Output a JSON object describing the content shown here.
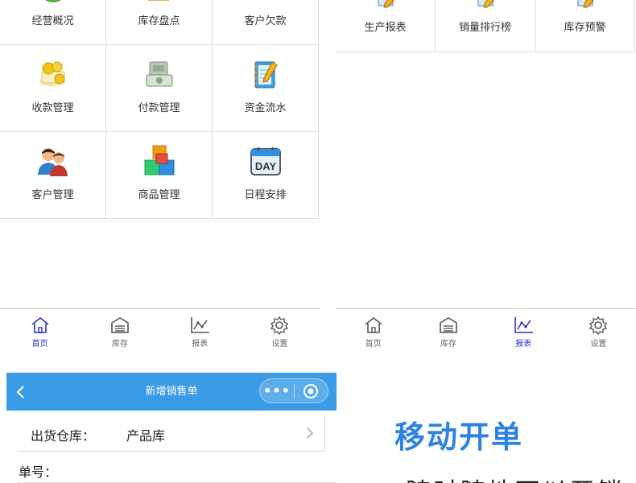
{
  "home": {
    "grid": [
      {
        "label": "经营概况",
        "icon": "overview-icon"
      },
      {
        "label": "库存盘点",
        "icon": "inventory-check-icon"
      },
      {
        "label": "客户欠款",
        "icon": "customer-debt-icon"
      },
      {
        "label": "收款管理",
        "icon": "receipt-coins-icon"
      },
      {
        "label": "付款管理",
        "icon": "payment-cash-icon"
      },
      {
        "label": "资金流水",
        "icon": "notebook-pencil-icon"
      },
      {
        "label": "客户管理",
        "icon": "customers-icon"
      },
      {
        "label": "商品管理",
        "icon": "product-boxes-icon"
      },
      {
        "label": "日程安排",
        "icon": "day-calendar-icon"
      }
    ],
    "tabs": [
      {
        "label": "首页",
        "icon": "home-icon",
        "active": true
      },
      {
        "label": "库存",
        "icon": "warehouse-icon",
        "active": false
      },
      {
        "label": "报表",
        "icon": "chart-icon",
        "active": false
      },
      {
        "label": "设置",
        "icon": "gear-icon",
        "active": false
      }
    ]
  },
  "reports": {
    "grid": [
      {
        "label": "生产报表",
        "icon": "report-doc-icon"
      },
      {
        "label": "销量排行榜",
        "icon": "report-doc-icon"
      },
      {
        "label": "库存预警",
        "icon": "report-doc-icon"
      }
    ],
    "tabs": [
      {
        "label": "首页",
        "icon": "home-icon",
        "active": false
      },
      {
        "label": "库存",
        "icon": "warehouse-icon",
        "active": false
      },
      {
        "label": "报表",
        "icon": "chart-icon",
        "active": true
      },
      {
        "label": "设置",
        "icon": "gear-icon",
        "active": false
      }
    ]
  },
  "sales_form": {
    "title": "新增销售单",
    "capsule_dots": "•••",
    "warehouse_label": "出货仓库：",
    "warehouse_value": "产品库",
    "order_no_label": "单号："
  },
  "promo": {
    "title": "移动开单",
    "subtitle": "随时随地可以开销"
  },
  "colors": {
    "nav_blue": "#3a9be7",
    "promo_blue": "#2d83e0",
    "active_tab": "#2a2fd0"
  }
}
